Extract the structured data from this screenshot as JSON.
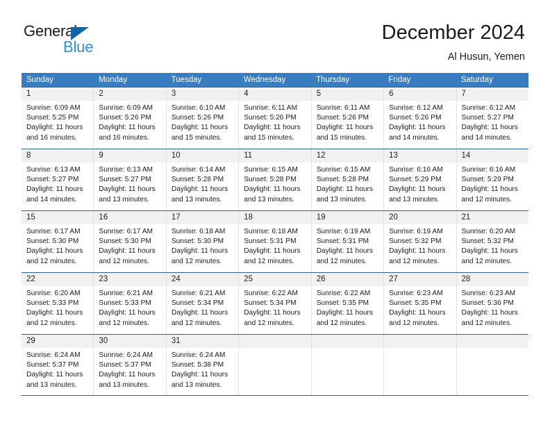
{
  "brand": {
    "name_top": "General",
    "name_bottom": "Blue",
    "triangle_color": "#1264a8",
    "blue_text_color": "#2e8bd8"
  },
  "header": {
    "title": "December 2024",
    "subtitle": "Al Husun, Yemen"
  },
  "theme": {
    "header_row_bg": "#3a7cc0",
    "header_row_text": "#ffffff",
    "week_border": "#2f5f8f",
    "daynum_band_bg": "#f1f1f1",
    "cell_divider": "#e2e2e2",
    "body_text": "#1a1a1a"
  },
  "weekdays": [
    "Sunday",
    "Monday",
    "Tuesday",
    "Wednesday",
    "Thursday",
    "Friday",
    "Saturday"
  ],
  "weeks": [
    [
      {
        "day": "1",
        "sunrise": "Sunrise: 6:09 AM",
        "sunset": "Sunset: 5:25 PM",
        "daylight1": "Daylight: 11 hours",
        "daylight2": "and 16 minutes."
      },
      {
        "day": "2",
        "sunrise": "Sunrise: 6:09 AM",
        "sunset": "Sunset: 5:26 PM",
        "daylight1": "Daylight: 11 hours",
        "daylight2": "and 16 minutes."
      },
      {
        "day": "3",
        "sunrise": "Sunrise: 6:10 AM",
        "sunset": "Sunset: 5:26 PM",
        "daylight1": "Daylight: 11 hours",
        "daylight2": "and 15 minutes."
      },
      {
        "day": "4",
        "sunrise": "Sunrise: 6:11 AM",
        "sunset": "Sunset: 5:26 PM",
        "daylight1": "Daylight: 11 hours",
        "daylight2": "and 15 minutes."
      },
      {
        "day": "5",
        "sunrise": "Sunrise: 6:11 AM",
        "sunset": "Sunset: 5:26 PM",
        "daylight1": "Daylight: 11 hours",
        "daylight2": "and 15 minutes."
      },
      {
        "day": "6",
        "sunrise": "Sunrise: 6:12 AM",
        "sunset": "Sunset: 5:26 PM",
        "daylight1": "Daylight: 11 hours",
        "daylight2": "and 14 minutes."
      },
      {
        "day": "7",
        "sunrise": "Sunrise: 6:12 AM",
        "sunset": "Sunset: 5:27 PM",
        "daylight1": "Daylight: 11 hours",
        "daylight2": "and 14 minutes."
      }
    ],
    [
      {
        "day": "8",
        "sunrise": "Sunrise: 6:13 AM",
        "sunset": "Sunset: 5:27 PM",
        "daylight1": "Daylight: 11 hours",
        "daylight2": "and 14 minutes."
      },
      {
        "day": "9",
        "sunrise": "Sunrise: 6:13 AM",
        "sunset": "Sunset: 5:27 PM",
        "daylight1": "Daylight: 11 hours",
        "daylight2": "and 13 minutes."
      },
      {
        "day": "10",
        "sunrise": "Sunrise: 6:14 AM",
        "sunset": "Sunset: 5:28 PM",
        "daylight1": "Daylight: 11 hours",
        "daylight2": "and 13 minutes."
      },
      {
        "day": "11",
        "sunrise": "Sunrise: 6:15 AM",
        "sunset": "Sunset: 5:28 PM",
        "daylight1": "Daylight: 11 hours",
        "daylight2": "and 13 minutes."
      },
      {
        "day": "12",
        "sunrise": "Sunrise: 6:15 AM",
        "sunset": "Sunset: 5:28 PM",
        "daylight1": "Daylight: 11 hours",
        "daylight2": "and 13 minutes."
      },
      {
        "day": "13",
        "sunrise": "Sunrise: 6:16 AM",
        "sunset": "Sunset: 5:29 PM",
        "daylight1": "Daylight: 11 hours",
        "daylight2": "and 13 minutes."
      },
      {
        "day": "14",
        "sunrise": "Sunrise: 6:16 AM",
        "sunset": "Sunset: 5:29 PM",
        "daylight1": "Daylight: 11 hours",
        "daylight2": "and 12 minutes."
      }
    ],
    [
      {
        "day": "15",
        "sunrise": "Sunrise: 6:17 AM",
        "sunset": "Sunset: 5:30 PM",
        "daylight1": "Daylight: 11 hours",
        "daylight2": "and 12 minutes."
      },
      {
        "day": "16",
        "sunrise": "Sunrise: 6:17 AM",
        "sunset": "Sunset: 5:30 PM",
        "daylight1": "Daylight: 11 hours",
        "daylight2": "and 12 minutes."
      },
      {
        "day": "17",
        "sunrise": "Sunrise: 6:18 AM",
        "sunset": "Sunset: 5:30 PM",
        "daylight1": "Daylight: 11 hours",
        "daylight2": "and 12 minutes."
      },
      {
        "day": "18",
        "sunrise": "Sunrise: 6:18 AM",
        "sunset": "Sunset: 5:31 PM",
        "daylight1": "Daylight: 11 hours",
        "daylight2": "and 12 minutes."
      },
      {
        "day": "19",
        "sunrise": "Sunrise: 6:19 AM",
        "sunset": "Sunset: 5:31 PM",
        "daylight1": "Daylight: 11 hours",
        "daylight2": "and 12 minutes."
      },
      {
        "day": "20",
        "sunrise": "Sunrise: 6:19 AM",
        "sunset": "Sunset: 5:32 PM",
        "daylight1": "Daylight: 11 hours",
        "daylight2": "and 12 minutes."
      },
      {
        "day": "21",
        "sunrise": "Sunrise: 6:20 AM",
        "sunset": "Sunset: 5:32 PM",
        "daylight1": "Daylight: 11 hours",
        "daylight2": "and 12 minutes."
      }
    ],
    [
      {
        "day": "22",
        "sunrise": "Sunrise: 6:20 AM",
        "sunset": "Sunset: 5:33 PM",
        "daylight1": "Daylight: 11 hours",
        "daylight2": "and 12 minutes."
      },
      {
        "day": "23",
        "sunrise": "Sunrise: 6:21 AM",
        "sunset": "Sunset: 5:33 PM",
        "daylight1": "Daylight: 11 hours",
        "daylight2": "and 12 minutes."
      },
      {
        "day": "24",
        "sunrise": "Sunrise: 6:21 AM",
        "sunset": "Sunset: 5:34 PM",
        "daylight1": "Daylight: 11 hours",
        "daylight2": "and 12 minutes."
      },
      {
        "day": "25",
        "sunrise": "Sunrise: 6:22 AM",
        "sunset": "Sunset: 5:34 PM",
        "daylight1": "Daylight: 11 hours",
        "daylight2": "and 12 minutes."
      },
      {
        "day": "26",
        "sunrise": "Sunrise: 6:22 AM",
        "sunset": "Sunset: 5:35 PM",
        "daylight1": "Daylight: 11 hours",
        "daylight2": "and 12 minutes."
      },
      {
        "day": "27",
        "sunrise": "Sunrise: 6:23 AM",
        "sunset": "Sunset: 5:35 PM",
        "daylight1": "Daylight: 11 hours",
        "daylight2": "and 12 minutes."
      },
      {
        "day": "28",
        "sunrise": "Sunrise: 6:23 AM",
        "sunset": "Sunset: 5:36 PM",
        "daylight1": "Daylight: 11 hours",
        "daylight2": "and 12 minutes."
      }
    ],
    [
      {
        "day": "29",
        "sunrise": "Sunrise: 6:24 AM",
        "sunset": "Sunset: 5:37 PM",
        "daylight1": "Daylight: 11 hours",
        "daylight2": "and 13 minutes."
      },
      {
        "day": "30",
        "sunrise": "Sunrise: 6:24 AM",
        "sunset": "Sunset: 5:37 PM",
        "daylight1": "Daylight: 11 hours",
        "daylight2": "and 13 minutes."
      },
      {
        "day": "31",
        "sunrise": "Sunrise: 6:24 AM",
        "sunset": "Sunset: 5:38 PM",
        "daylight1": "Daylight: 11 hours",
        "daylight2": "and 13 minutes."
      },
      {
        "day": "",
        "sunrise": "",
        "sunset": "",
        "daylight1": "",
        "daylight2": ""
      },
      {
        "day": "",
        "sunrise": "",
        "sunset": "",
        "daylight1": "",
        "daylight2": ""
      },
      {
        "day": "",
        "sunrise": "",
        "sunset": "",
        "daylight1": "",
        "daylight2": ""
      },
      {
        "day": "",
        "sunrise": "",
        "sunset": "",
        "daylight1": "",
        "daylight2": ""
      }
    ]
  ]
}
